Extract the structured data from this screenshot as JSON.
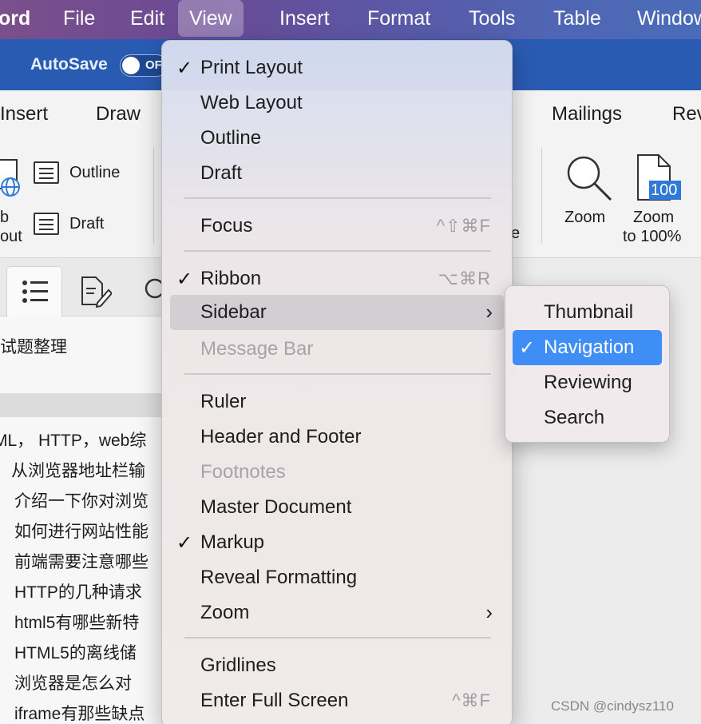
{
  "menubar": {
    "app": "ord",
    "items": [
      "File",
      "Edit",
      "View",
      "Insert",
      "Format",
      "Tools",
      "Table",
      "Window"
    ],
    "active": "View"
  },
  "titlebar": {
    "autosave_label": "AutoSave",
    "toggle_text": "OF"
  },
  "ribbon": {
    "tabs": [
      "Insert",
      "Draw",
      "Mailings",
      "Rev"
    ],
    "views": {
      "web_partial_1": "b",
      "web_partial_2": "out",
      "outline": "Outline",
      "draft": "Draft"
    },
    "zoom": {
      "zoom_label": "Zoom",
      "zoom100_line1": "Zoom",
      "zoom100_line2": "to 100%",
      "zoom100_badge": "100"
    },
    "partial_letter": "e"
  },
  "sidebar": {
    "heading": "试题整理",
    "partial_line": "ML， HTTP，web综",
    "items": [
      "从浏览器地址栏输",
      "介绍一下你对浏览",
      "如何进行网站性能",
      "前端需要注意哪些",
      "HTTP的几种请求",
      "html5有哪些新特",
      "HTML5的离线储",
      "浏览器是怎么对",
      "iframe有那些缺点"
    ]
  },
  "view_menu": {
    "group1": [
      {
        "label": "Print Layout",
        "checked": true
      },
      {
        "label": "Web Layout",
        "checked": false
      },
      {
        "label": "Outline",
        "checked": false
      },
      {
        "label": "Draft",
        "checked": false
      }
    ],
    "focus": {
      "label": "Focus",
      "shortcut": "^⇧⌘F"
    },
    "ribbon": {
      "label": "Ribbon",
      "shortcut": "⌥⌘R",
      "checked": true
    },
    "sidebar": {
      "label": "Sidebar",
      "highlighted": true
    },
    "message_bar": {
      "label": "Message Bar",
      "disabled": true
    },
    "group3": [
      {
        "label": "Ruler",
        "disabled": false,
        "checked": false
      },
      {
        "label": "Header and Footer",
        "disabled": false,
        "checked": false
      },
      {
        "label": "Footnotes",
        "disabled": true,
        "checked": false
      },
      {
        "label": "Master Document",
        "disabled": false,
        "checked": false
      },
      {
        "label": "Markup",
        "disabled": false,
        "checked": true
      },
      {
        "label": "Reveal Formatting",
        "disabled": false,
        "checked": false
      }
    ],
    "zoom": {
      "label": "Zoom"
    },
    "gridlines": {
      "label": "Gridlines"
    },
    "full_screen": {
      "label": "Enter Full Screen",
      "shortcut": "^⌘F"
    }
  },
  "sidebar_submenu": {
    "items": [
      {
        "label": "Thumbnail",
        "selected": false
      },
      {
        "label": "Navigation",
        "selected": true
      },
      {
        "label": "Reviewing",
        "selected": false
      },
      {
        "label": "Search",
        "selected": false
      }
    ]
  },
  "watermark": "CSDN @cindysz110",
  "colors": {
    "menubar_start": "#7a4f8c",
    "menubar_end": "#4a6cb8",
    "title_blue": "#2a5bb3",
    "selection_blue": "#3f8ef5"
  }
}
